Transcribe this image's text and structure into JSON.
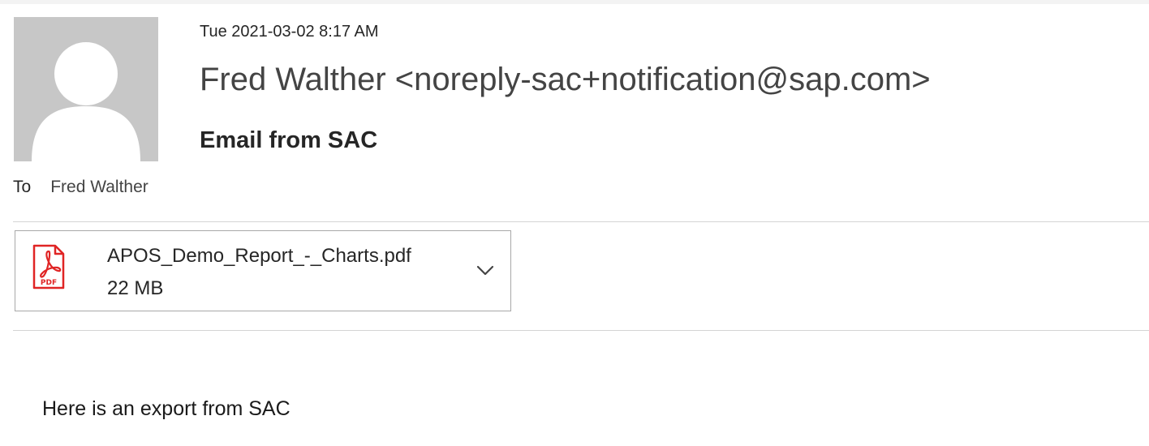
{
  "message": {
    "date": "Tue 2021-03-02 8:17 AM",
    "sender": "Fred Walther <noreply-sac+notification@sap.com>",
    "subject": "Email from SAC",
    "to_label": "To",
    "to_name": "Fred Walther"
  },
  "attachment": {
    "icon": "pdf-file-icon",
    "icon_label": "PDF",
    "name": "APOS_Demo_Report_-_Charts.pdf",
    "size": "22 MB"
  },
  "body": {
    "text": "Here is an export from SAC"
  },
  "colors": {
    "pdf_red": "#e02424",
    "avatar_bg": "#c7c7c7"
  }
}
